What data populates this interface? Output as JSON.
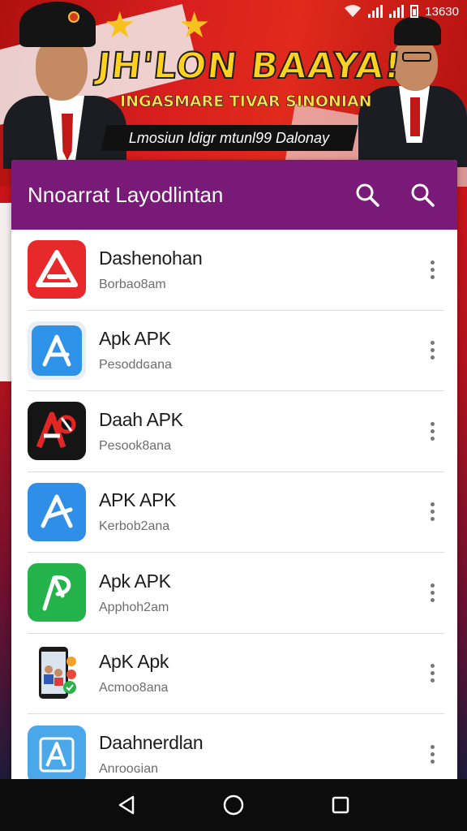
{
  "status_bar": {
    "time": "13630",
    "icons": [
      "wifi-icon",
      "signal-icon",
      "signal-icon",
      "battery-icon"
    ]
  },
  "banner": {
    "headline": "JH'LON BAAYA!",
    "subline": "INGASMARE TIVAR SINONIAN",
    "ribbon": "Lmosiun ldigr mtunl99  Dalonay"
  },
  "toolbar": {
    "title": "Nnoarrat Layodlintan",
    "search_icon": "search-icon",
    "search_icon_2": "search-icon"
  },
  "apps": [
    {
      "name": "Dashenohan",
      "subtitle": "Borbao8am",
      "icon": "a-logo-red",
      "color": "#e8292b"
    },
    {
      "name": "Apk APK",
      "subtitle": "Pesoddɢana",
      "icon": "a-logo-blue",
      "color": "#2f92e9"
    },
    {
      "name": "Daah APK",
      "subtitle": "Pesook8ana",
      "icon": "a-logo-black",
      "color": "#151515"
    },
    {
      "name": "APK APK",
      "subtitle": "Kerbob2ana",
      "icon": "a-logo-blue",
      "color": "#2f8fe8"
    },
    {
      "name": "Apk APK",
      "subtitle": "Apphoh2am",
      "icon": "a-logo-green",
      "color": "#24b34b"
    },
    {
      "name": "ApK Apk",
      "subtitle": "Acmoo8ana",
      "icon": "phone-app-icon",
      "color": "#ffffff"
    },
    {
      "name": "Daahnerdlan",
      "subtitle": "Anrooɢian",
      "icon": "a-logo-lightblue",
      "color": "#4aa7ea"
    }
  ],
  "navbar": {
    "back_icon": "back-triangle-icon",
    "home_icon": "home-circle-icon",
    "recents_icon": "recents-square-icon"
  },
  "colors": {
    "toolbar": "#7a1a78",
    "banner_red": "#d81e1e",
    "headline_yellow": "#ffd21f"
  }
}
